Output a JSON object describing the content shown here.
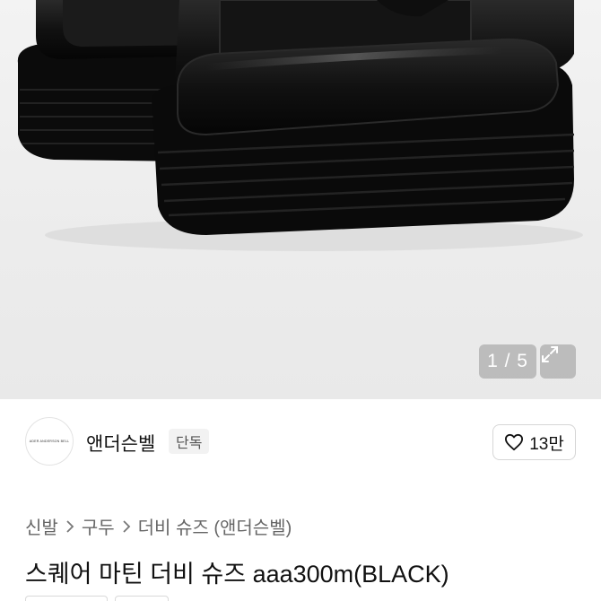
{
  "gallery": {
    "counter": "1 / 5",
    "image_alt": "black square toe derby shoes",
    "expand_icon": "expand-icon"
  },
  "brand": {
    "logo_text": "ADER ANDERSON BELL",
    "name": "앤더슨벨",
    "exclusive_badge": "단독"
  },
  "like": {
    "icon": "heart-icon",
    "count": "13만"
  },
  "breadcrumb": {
    "items": [
      "신발",
      "구두",
      "더비 슈즈 (앤더슨벨)"
    ]
  },
  "product": {
    "title": "스퀘어 마틴 더비 슈즈 aaa300m(BLACK)"
  }
}
